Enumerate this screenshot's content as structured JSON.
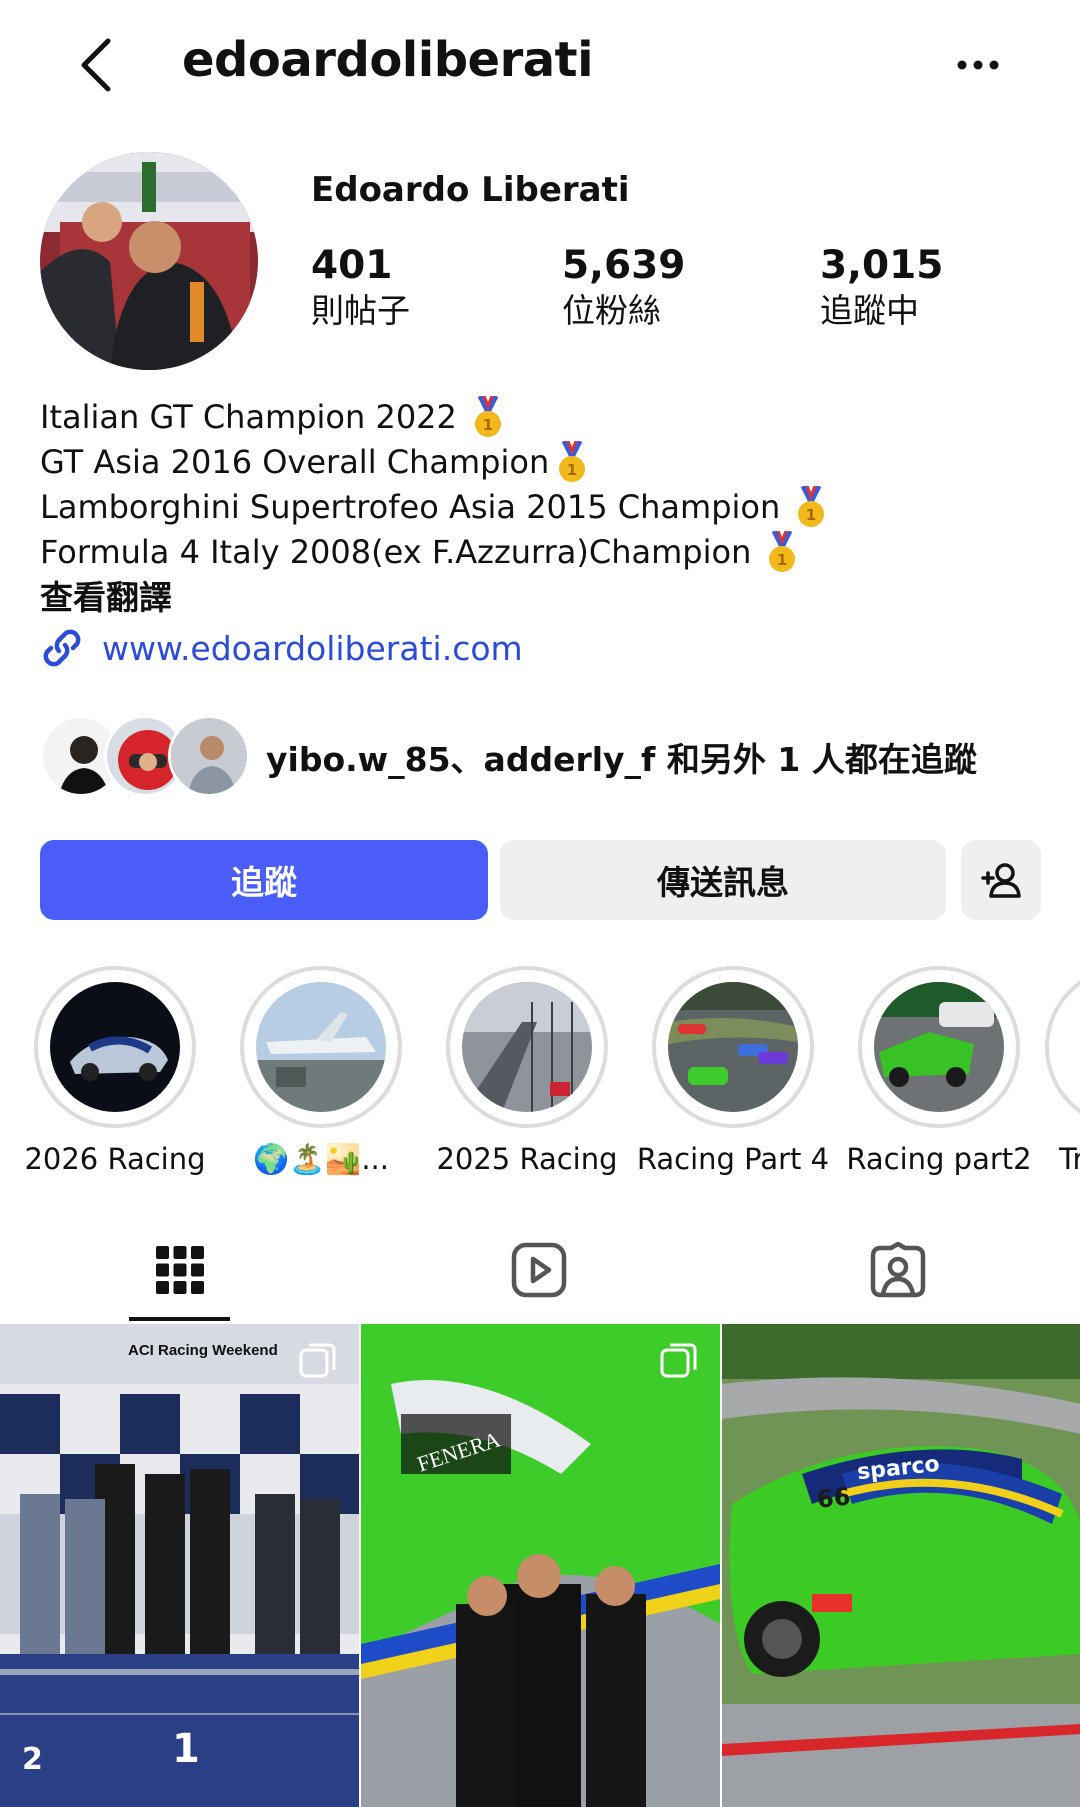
{
  "header": {
    "username": "edoardoliberati"
  },
  "profile": {
    "display_name": "Edoardo Liberati",
    "stats": [
      {
        "value": "401",
        "label": "則帖子"
      },
      {
        "value": "5,639",
        "label": "位粉絲"
      },
      {
        "value": "3,015",
        "label": "追蹤中"
      }
    ],
    "bio_lines": [
      "Italian GT Champion 2022",
      "GT Asia 2016 Overall Champion",
      "Lamborghini Supertrofeo Asia 2015 Champion",
      "Formula 4 Italy 2008(ex F.Azzurra)Champion"
    ],
    "translate_label": "查看翻譯",
    "website": "www.edoardoliberati.com",
    "followed_by_text": "yibo.w_85、adderly_f 和另外 1 人都在追蹤"
  },
  "actions": {
    "follow_label": "追蹤",
    "message_label": "傳送訊息"
  },
  "highlights": [
    {
      "label": "2026 Racing"
    },
    {
      "label": "🌍🏝️🏜️..."
    },
    {
      "label": "2025 Racing"
    },
    {
      "label": "Racing Part 4"
    },
    {
      "label": "Racing part2"
    },
    {
      "label": "Tr"
    }
  ],
  "tabs": [
    {
      "icon": "grid-icon",
      "active": true
    },
    {
      "icon": "reels-icon",
      "active": false
    },
    {
      "icon": "tagged-icon",
      "active": false
    }
  ],
  "grid_posts": [
    {
      "overlay_text": "ACI Racing Weekend",
      "number_left": "2",
      "number_right": "1"
    },
    {
      "overlay_text": "FENERA"
    },
    {
      "overlay_text": "sparco",
      "car_number": "66"
    }
  ],
  "colors": {
    "follow_button": "#4a5df9",
    "link": "#2c4bd6",
    "secondary_button": "#efefef"
  }
}
